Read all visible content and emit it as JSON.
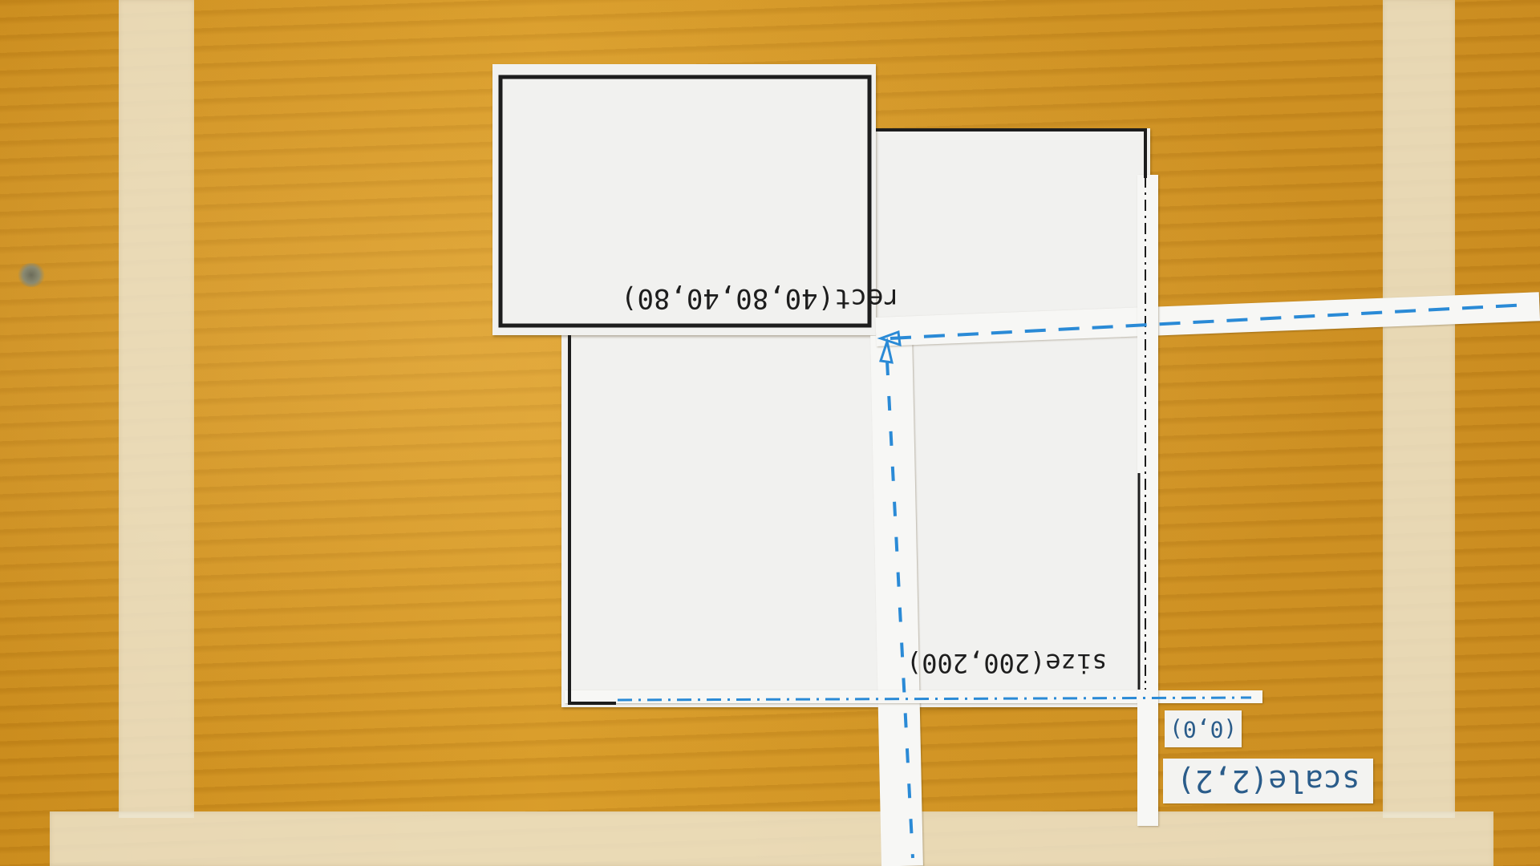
{
  "scene": {
    "background": "wooden-desk",
    "colors": {
      "wood": "#c98c1c",
      "tape": "#eee8d4",
      "paper": "#f1f1ef",
      "ink_black": "#1d1d1d",
      "ink_blue": "#2a8ad6"
    }
  },
  "labels": {
    "canvas_size": "size(200,200)",
    "rect_call": "rect(40,80,40,80)",
    "origin": "(0,0)",
    "transform": "scale(2,2)"
  },
  "icons": {
    "arrow_up": "arrow-up-icon",
    "arrow_left": "arrow-left-icon"
  }
}
